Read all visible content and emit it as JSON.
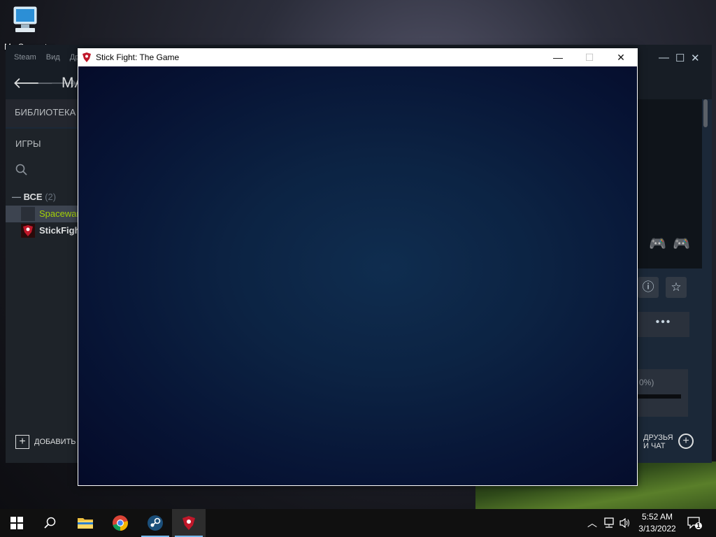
{
  "desktop": {
    "icon_label": "My Computer"
  },
  "steam": {
    "menu": [
      "Steam",
      "Вид",
      "Др"
    ],
    "nav_title": "MA",
    "library_label": "БИБЛИОТЕКА",
    "games_label": "ИГРЫ",
    "all_label": "ВСЕ",
    "all_count": "(2)",
    "games": [
      {
        "name": "Spacewar",
        "color": "#a4d007"
      },
      {
        "name": "StickFight",
        "color": "#dcdedf"
      }
    ],
    "add_label": "ДОБАВИТЬ",
    "download_pct": "0%)",
    "friends_line1": "ДРУЗЬЯ",
    "friends_line2": "И ЧАТ"
  },
  "game_window": {
    "title": "Stick Fight: The Game",
    "minimize": "—",
    "maximize": "☐",
    "close": "✕"
  },
  "taskbar": {
    "time": "5:52 AM",
    "date": "3/13/2022",
    "notification_count": "1"
  }
}
